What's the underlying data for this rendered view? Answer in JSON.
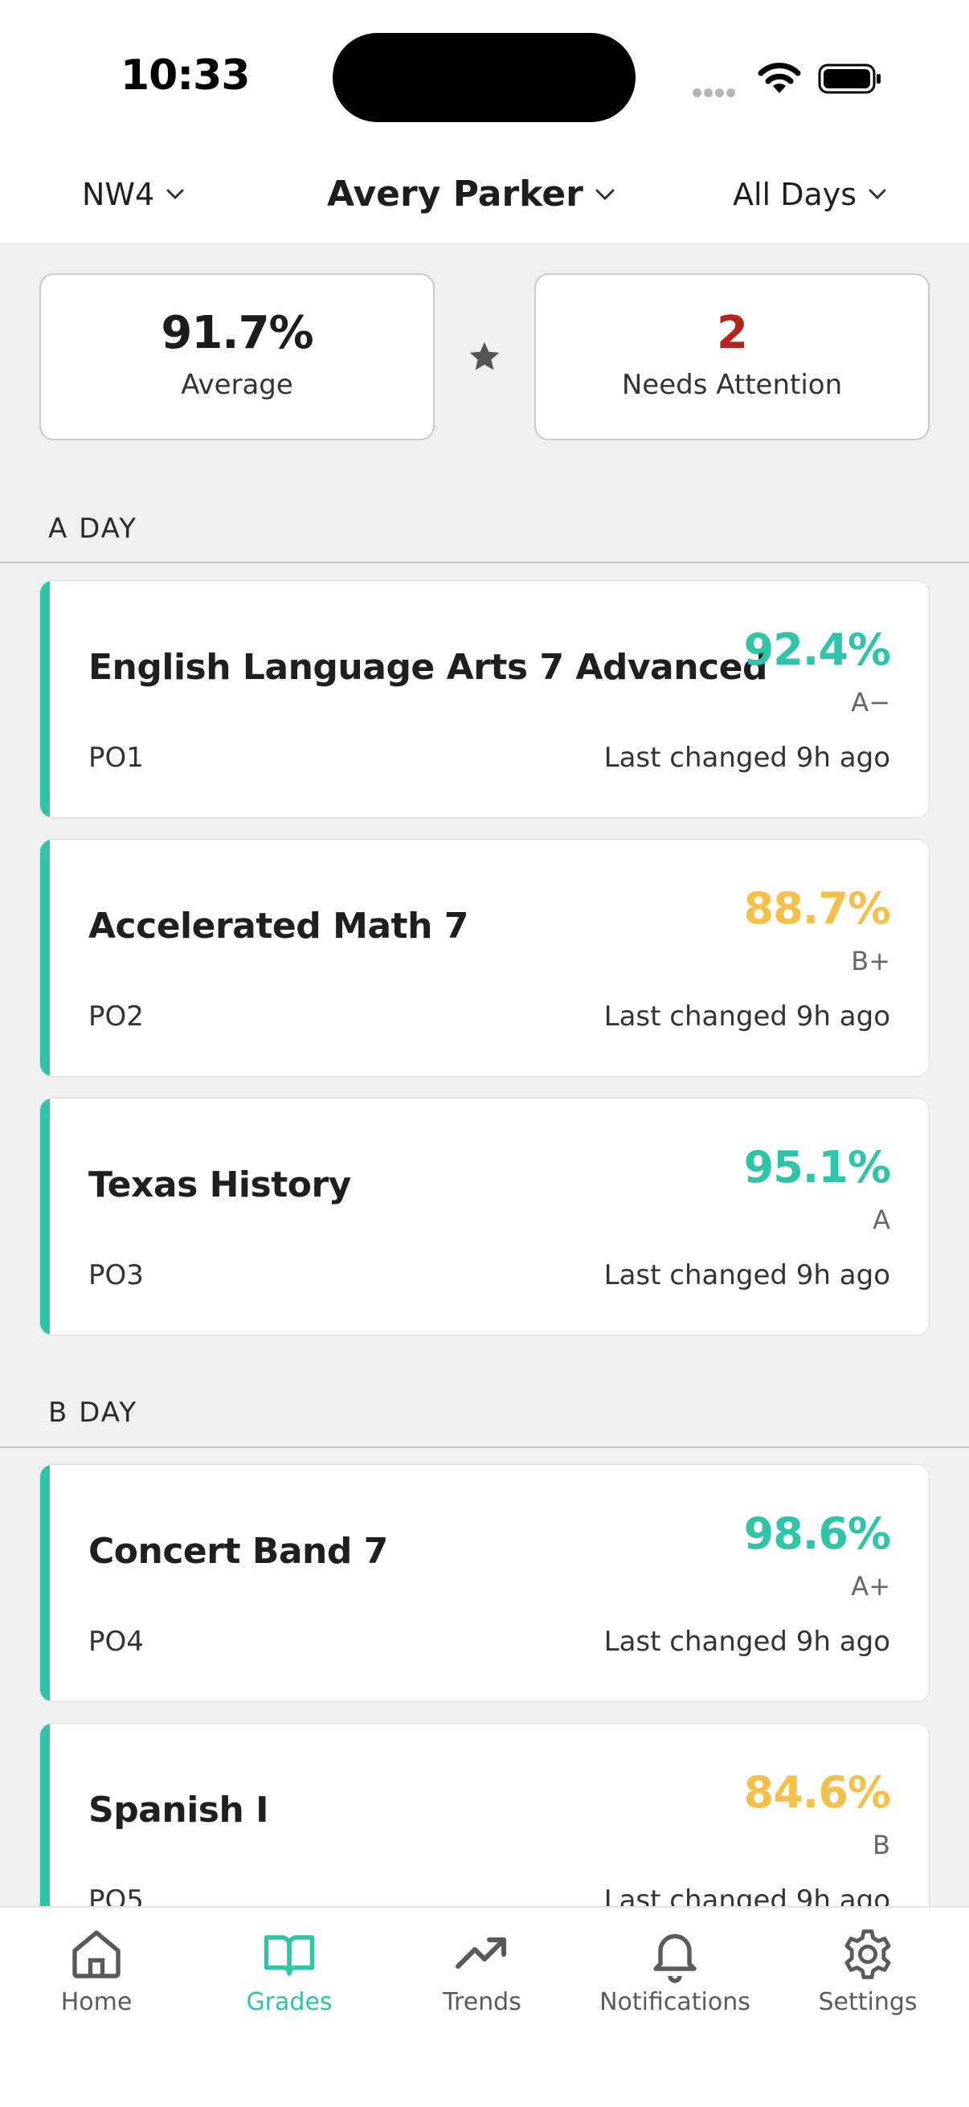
{
  "status_bar": {
    "time": "10:33"
  },
  "header": {
    "period_selector": "NW4",
    "student_selector": "Avery Parker",
    "days_selector": "All Days"
  },
  "summary": {
    "average_value": "91.7%",
    "average_label": "Average",
    "attention_value": "2",
    "attention_label": "Needs Attention"
  },
  "sections": [
    {
      "title": "A DAY",
      "courses": [
        {
          "name": "English Language Arts 7 Advanced",
          "percent": "92.4%",
          "letter": "A−",
          "period": "PO1",
          "changed": "Last changed 9h ago"
        },
        {
          "name": "Accelerated Math 7",
          "percent": "88.7%",
          "letter": "B+",
          "period": "PO2",
          "changed": "Last changed 9h ago"
        },
        {
          "name": "Texas History",
          "percent": "95.1%",
          "letter": "A",
          "period": "PO3",
          "changed": "Last changed 9h ago"
        }
      ]
    },
    {
      "title": "B DAY",
      "courses": [
        {
          "name": "Concert Band 7",
          "percent": "98.6%",
          "letter": "A+",
          "period": "PO4",
          "changed": "Last changed 9h ago"
        },
        {
          "name": "Spanish I",
          "percent": "84.6%",
          "letter": "B",
          "period": "PO5",
          "changed": "Last changed 9h ago"
        }
      ]
    }
  ],
  "tabs": [
    {
      "label": "Home",
      "icon": "home-icon"
    },
    {
      "label": "Grades",
      "icon": "book-icon"
    },
    {
      "label": "Trends",
      "icon": "trend-icon"
    },
    {
      "label": "Notifications",
      "icon": "bell-icon"
    },
    {
      "label": "Settings",
      "icon": "gear-icon"
    }
  ],
  "colors": {
    "accent": "#2ec4a8",
    "grade_good": "#2ec4a8",
    "grade_warning": "#f5c04a",
    "attention": "#b3261e"
  }
}
